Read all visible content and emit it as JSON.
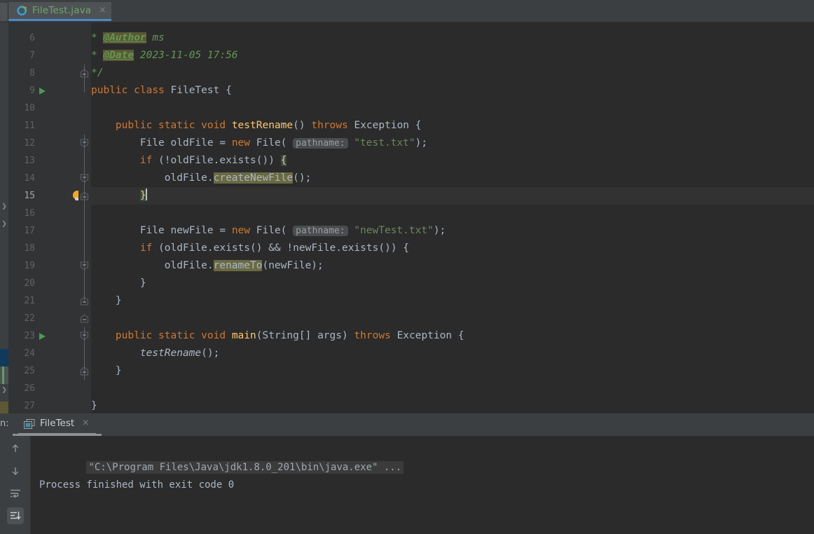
{
  "window": {
    "accent_tab": "#4a88c7",
    "bg": "#2b2b2b",
    "panel_bg": "#3c3f41"
  },
  "tabbar": {
    "tab": {
      "label": "FileTest.java",
      "icon": "java-class-icon",
      "close": "×",
      "active": true
    }
  },
  "editor": {
    "first_line": 6,
    "lines": [
      {
        "n": 6,
        "run": false,
        "bulb": false,
        "current": false,
        "indent": 0
      },
      {
        "n": 7,
        "run": false,
        "bulb": false,
        "current": false,
        "indent": 0
      },
      {
        "n": 8,
        "run": false,
        "bulb": false,
        "current": false,
        "indent": 0
      },
      {
        "n": 9,
        "run": true,
        "bulb": false,
        "current": false,
        "indent": 0
      },
      {
        "n": 10,
        "run": false,
        "bulb": false,
        "current": false,
        "indent": 0
      },
      {
        "n": 11,
        "run": false,
        "bulb": false,
        "current": false,
        "indent": 0
      },
      {
        "n": 12,
        "run": false,
        "bulb": false,
        "current": false,
        "indent": 0
      },
      {
        "n": 13,
        "run": false,
        "bulb": false,
        "current": false,
        "indent": 0
      },
      {
        "n": 14,
        "run": false,
        "bulb": false,
        "current": false,
        "indent": 0
      },
      {
        "n": 15,
        "run": false,
        "bulb": true,
        "current": true,
        "indent": 0
      },
      {
        "n": 16,
        "run": false,
        "bulb": false,
        "current": false,
        "indent": 0
      },
      {
        "n": 17,
        "run": false,
        "bulb": false,
        "current": false,
        "indent": 0
      },
      {
        "n": 18,
        "run": false,
        "bulb": false,
        "current": false,
        "indent": 0
      },
      {
        "n": 19,
        "run": false,
        "bulb": false,
        "current": false,
        "indent": 0
      },
      {
        "n": 20,
        "run": false,
        "bulb": false,
        "current": false,
        "indent": 0
      },
      {
        "n": 21,
        "run": false,
        "bulb": false,
        "current": false,
        "indent": 0
      },
      {
        "n": 22,
        "run": false,
        "bulb": false,
        "current": false,
        "indent": 0
      },
      {
        "n": 23,
        "run": true,
        "bulb": false,
        "current": false,
        "indent": 0
      },
      {
        "n": 24,
        "run": false,
        "bulb": false,
        "current": false,
        "indent": 0
      },
      {
        "n": 25,
        "run": false,
        "bulb": false,
        "current": false,
        "indent": 0
      },
      {
        "n": 26,
        "run": false,
        "bulb": false,
        "current": false,
        "indent": 0
      },
      {
        "n": 27,
        "run": false,
        "bulb": false,
        "current": false,
        "indent": 0
      }
    ],
    "code_text": {
      "l6": "     * @Author ms",
      "l7": "     * @Date 2023-11-05 17:56",
      "l8": "     */",
      "l9": "    public class FileTest {",
      "l10": "",
      "l11": "        public static void testRename() throws Exception {",
      "l12": "            File oldFile = new File( pathname: \"test.txt\");",
      "l13": "            if (!oldFile.exists()) {",
      "l14": "                oldFile.createNewFile();",
      "l15": "            }",
      "l16": "",
      "l17": "            File newFile = new File( pathname: \"newTest.txt\");",
      "l18": "            if (oldFile.exists() && !newFile.exists()) {",
      "l19": "                oldFile.renameTo(newFile);",
      "l20": "            }",
      "l21": "        }",
      "l22": "",
      "l23": "        public static void main(String[] args) throws Exception {",
      "l24": "            testRename();",
      "l25": "        }",
      "l26": "",
      "l27": "    }"
    },
    "tokens": {
      "star": "*",
      "tag_author": "@Author",
      "author_value": "ms",
      "tag_date": "@Date",
      "date_value": "2023-11-05 17:56",
      "comment_end": "*/",
      "kw_public": "public",
      "kw_class": "class",
      "kw_static": "static",
      "kw_void": "void",
      "kw_new": "new",
      "kw_if": "if",
      "kw_throws": "throws",
      "type_File": "File",
      "type_Exception": "Exception",
      "type_String": "String[]",
      "name_FileTest": "FileTest",
      "name_testRename": "testRename",
      "name_main": "main",
      "name_args": "args",
      "var_oldFile": "oldFile",
      "var_newFile": "newFile",
      "m_exists": "exists",
      "m_createNewFile": "createNewFile",
      "m_renameTo": "renameTo",
      "hint_pathname": "pathname:",
      "str_test": "\"test.txt\"",
      "str_newtest": "\"newTest.txt\"",
      "brace_open": "{",
      "brace_close": "}"
    }
  },
  "run_panel": {
    "title": "n:",
    "tab": {
      "label": "FileTest",
      "icon": "console-window-icon",
      "close": "×"
    },
    "toolbar": [
      {
        "name": "up-arrow-icon",
        "glyph": "↑",
        "active": false
      },
      {
        "name": "down-arrow-icon",
        "glyph": "↓",
        "active": false
      },
      {
        "name": "soft-wrap-icon",
        "glyph": "",
        "active": false
      },
      {
        "name": "scroll-to-end-icon",
        "glyph": "",
        "active": true
      }
    ],
    "output": {
      "command": "\"C:\\Program Files\\Java\\jdk1.8.0_201\\bin\\java.exe\" ...",
      "result": "Process finished with exit code 0"
    }
  }
}
